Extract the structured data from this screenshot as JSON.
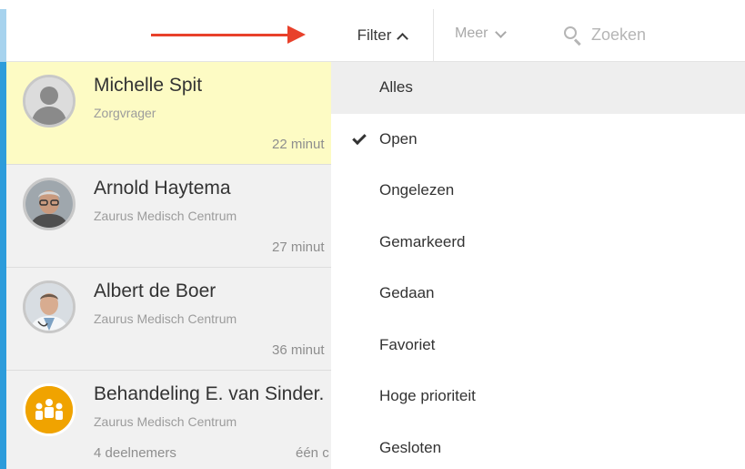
{
  "toolbar": {
    "filter_label": "Filter",
    "meer_label": "Meer",
    "search_placeholder": "Zoeken"
  },
  "conversations": [
    {
      "name": "Michelle Spit",
      "subtitle": "Zorgvrager",
      "time": "22 minut",
      "selected": true
    },
    {
      "name": "Arnold Haytema",
      "subtitle": "Zaurus Medisch Centrum",
      "time": "27 minut"
    },
    {
      "name": "Albert de Boer",
      "subtitle": "Zaurus Medisch Centrum",
      "time": "36 minut"
    },
    {
      "name": "Behandeling E. van Sinder.",
      "subtitle": "Zaurus Medisch Centrum",
      "participants": "4 deelnemers",
      "time": "één c"
    }
  ],
  "filter_menu": {
    "items": [
      "Alles",
      "Open",
      "Ongelezen",
      "Gemarkeerd",
      "Gedaan",
      "Favoriet",
      "Hoge prioriteit",
      "Gesloten"
    ],
    "checked": "Open",
    "highlighted": "Alles"
  },
  "colors": {
    "accent_blue": "#2d9cdb",
    "selected_bg": "#fdfbc4",
    "annotation_arrow": "#e8412b",
    "group_avatar": "#f0a300"
  }
}
